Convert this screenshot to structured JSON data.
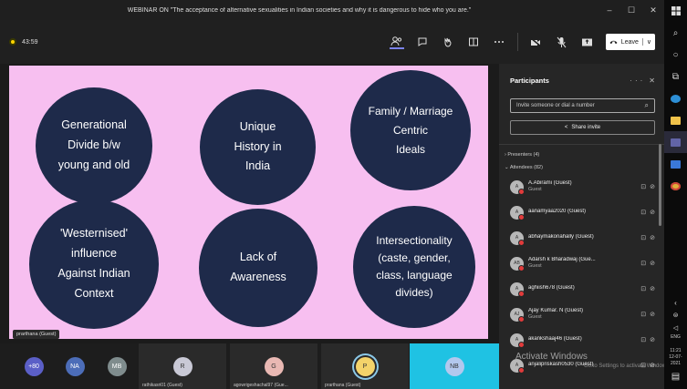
{
  "window": {
    "title": "WEBINAR ON \"The acceptance of alternative sexualities in Indian societies and why it is dangerous to hide who you are.\"",
    "min": "–",
    "max": "☐",
    "close": "✕"
  },
  "toolbar": {
    "timer": "43:59",
    "leave_label": "Leave",
    "leave_caret": "∨"
  },
  "slide": {
    "items": [
      {
        "text": "Generational\nDivide b/w\nyoung and old"
      },
      {
        "text": "Unique\nHistory in\nIndia"
      },
      {
        "text": "Family / Marriage\nCentric\nIdeals"
      },
      {
        "text": "'Westernised'\ninfluence\nAgainst Indian\nContext"
      },
      {
        "text": "Lack of\nAwareness"
      },
      {
        "text": "Intersectionality\n(caste, gender,\nclass, language\ndivides)"
      }
    ],
    "presenter_chip": "prarthana (Guest)"
  },
  "participants": {
    "title": "Participants",
    "more": "···",
    "close": "✕",
    "invite_placeholder": "Invite someone or dial a number",
    "share_invite": "Share invite",
    "presenters_section": "Presenters (4)",
    "attendees_section": "Attendees (82)",
    "list": [
      {
        "initials": "A",
        "name": "A.Abirami (Guest)",
        "sub": "Guest"
      },
      {
        "initials": "A",
        "name": "aanamyaa2020 (Guest)",
        "sub": ""
      },
      {
        "initials": "A",
        "name": "abhaymakonahally (Guest)",
        "sub": ""
      },
      {
        "initials": "AB",
        "name": "Adarsh k Bharadwaj (Gue...",
        "sub": "Guest"
      },
      {
        "initials": "A",
        "name": "aghiish678 (Guest)",
        "sub": ""
      },
      {
        "initials": "AJ",
        "name": "Ajay Kumar. N (Guest)",
        "sub": "Guest"
      },
      {
        "initials": "A",
        "name": "akankshaaj46 (Guest)",
        "sub": ""
      },
      {
        "initials": "A",
        "name": "anjalipriskash0530 (Guest)",
        "sub": ""
      }
    ],
    "watermark": "Activate Windows",
    "watermark_sub": "Go to Settings to activate Windows."
  },
  "strip": {
    "tiles": [
      {
        "initials": "+80",
        "color": "#5b5fc7",
        "label": ""
      },
      {
        "initials": "NA",
        "color": "#4c6db8",
        "label": ""
      },
      {
        "initials": "MB",
        "color": "#7f8c8d",
        "label": ""
      },
      {
        "initials": "R",
        "color": "#c9c9d6",
        "label": "rathikasri01 (Guest)"
      },
      {
        "initials": "G",
        "color": "#e9b8b3",
        "label": "agowrigeshachal97 (Gue..."
      },
      {
        "initials": "P",
        "color": "#f3d36a",
        "label": "prarthana (Guest)"
      },
      {
        "initials": "NB",
        "color": "#b3c8ee",
        "label": ""
      }
    ]
  },
  "taskbar": {
    "lang": "ENG",
    "time": "11:21",
    "date": "12-07-2021"
  },
  "colors": {
    "slide_bg": "#f7bff0",
    "circle": "#1e2a4a",
    "accent": "#7b83eb",
    "video_tile": "#1fc2e3"
  }
}
